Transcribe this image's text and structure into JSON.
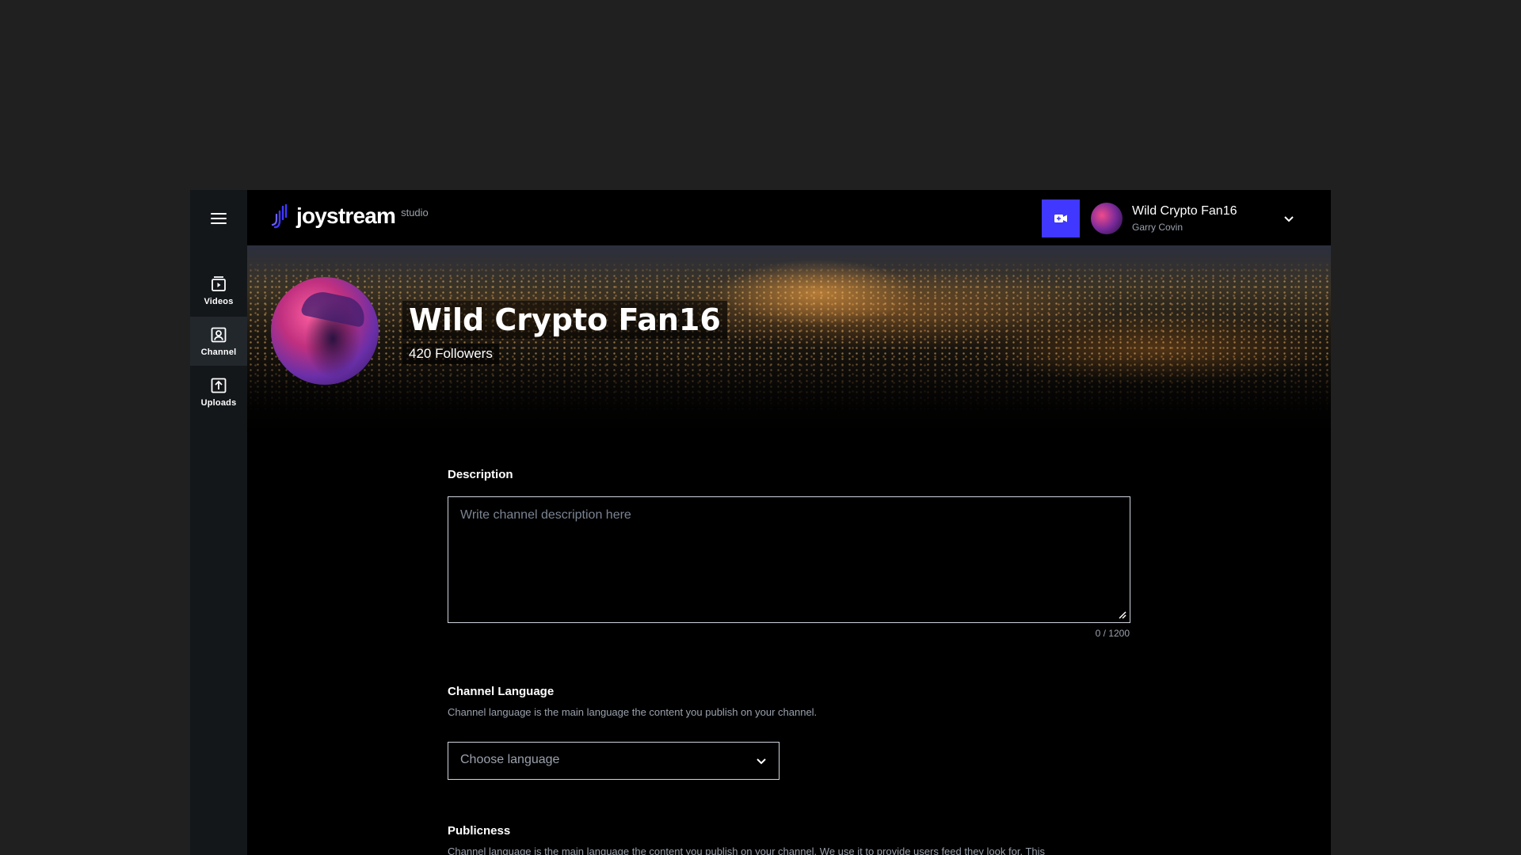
{
  "app": {
    "logo_text": "joystream",
    "logo_suffix": "studio"
  },
  "sidebar": {
    "menu_icon": "hamburger-icon",
    "items": [
      {
        "label": "Videos",
        "icon": "video-list-icon",
        "active": false
      },
      {
        "label": "Channel",
        "icon": "channel-user-icon",
        "active": true
      },
      {
        "label": "Uploads",
        "icon": "upload-icon",
        "active": false
      }
    ]
  },
  "header": {
    "upload_button_icon": "video-add-icon",
    "account": {
      "channel_name": "Wild Crypto Fan16",
      "member_name": "Garry Covin",
      "chevron_icon": "chevron-down-icon"
    }
  },
  "channel": {
    "title": "Wild Crypto Fan16",
    "followers": "420 Followers"
  },
  "form": {
    "description": {
      "label": "Description",
      "placeholder": "Write channel description here",
      "counter": "0 / 1200"
    },
    "language": {
      "label": "Channel Language",
      "helper": "Channel language is the main language the content you publish on your channel.",
      "placeholder": "Choose language"
    },
    "publicness": {
      "label": "Publicness",
      "helper": "Channel language is the main language the content you publish on your channel. We use it to provide users feed they look for. This"
    }
  },
  "colors": {
    "accent": "#4038ff",
    "background": "#000000",
    "page": "#202020"
  }
}
